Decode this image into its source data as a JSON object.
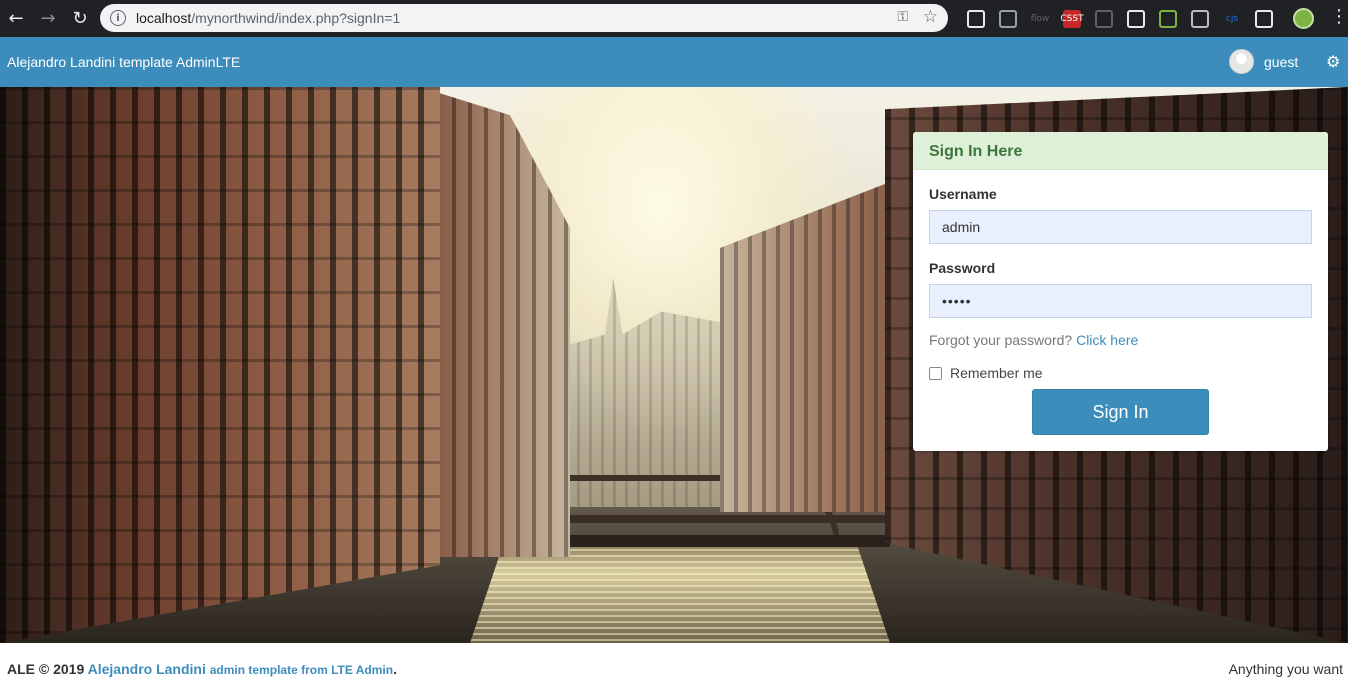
{
  "browser": {
    "url_host": "localhost",
    "url_path": "/mynorthwind/index.php?signIn=1",
    "extensions": [
      {
        "name": "ext-icon-1",
        "label": "",
        "color": "#e8eaed"
      },
      {
        "name": "spotify-icon",
        "label": "",
        "color": "#9aa0a6"
      },
      {
        "name": "flow-icon",
        "label": "flow",
        "color": "#5f6368"
      },
      {
        "name": "cssr-icon",
        "label": "CSST",
        "color": "#ffffff"
      },
      {
        "name": "wrench-icon",
        "label": "",
        "color": "#5f6368"
      },
      {
        "name": "pen-icon",
        "label": "",
        "color": "#e8eaed"
      },
      {
        "name": "leaf-icon",
        "label": "",
        "color": "#7cb342"
      },
      {
        "name": "image-icon",
        "label": "",
        "color": "#bdbdbd"
      },
      {
        "name": "cjs-icon",
        "label": "cjs",
        "color": "#1a73e8"
      },
      {
        "name": "chat-icon",
        "label": "",
        "color": "#e8eaed"
      }
    ]
  },
  "header": {
    "brand": "Alejandro Landini template AdminLTE",
    "user": "guest"
  },
  "login": {
    "title": "Sign In Here",
    "username_label": "Username",
    "username_value": "admin",
    "password_label": "Password",
    "password_value": "•••••",
    "forgot_text": "Forgot your password?",
    "forgot_link": "Click here",
    "remember_label": "Remember me",
    "remember_checked": false,
    "submit_label": "Sign In"
  },
  "footer": {
    "prefix": "ALE © 2019",
    "author_link": "Alejandro Landini",
    "suffix_link": "admin template from LTE Admin",
    "period": ".",
    "right_text": "Anything you want"
  },
  "colors": {
    "primary": "#3c8dbc",
    "panel_head_bg": "#dff0d8",
    "panel_head_text": "#3c763d"
  }
}
